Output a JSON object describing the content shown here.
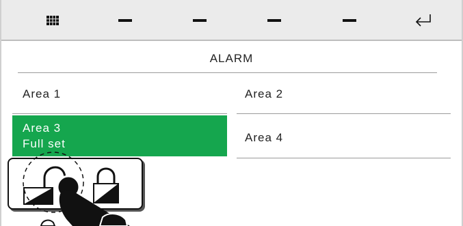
{
  "toolbar": {
    "buttons": [
      {
        "icon": "keypad-icon"
      },
      {
        "icon": "dash-icon"
      },
      {
        "icon": "dash-icon"
      },
      {
        "icon": "dash-icon"
      },
      {
        "icon": "dash-icon"
      },
      {
        "icon": "enter-icon"
      }
    ]
  },
  "screen": {
    "title": "ALARM"
  },
  "areas": [
    {
      "label": "Area 1"
    },
    {
      "label": "Area 2"
    },
    {
      "label": "Area 3",
      "status": "Full set",
      "selected": true,
      "color": "#15a64e"
    },
    {
      "label": "Area 4"
    }
  ],
  "popup": {
    "icons": [
      "unlock-icon",
      "lock-icon"
    ]
  }
}
